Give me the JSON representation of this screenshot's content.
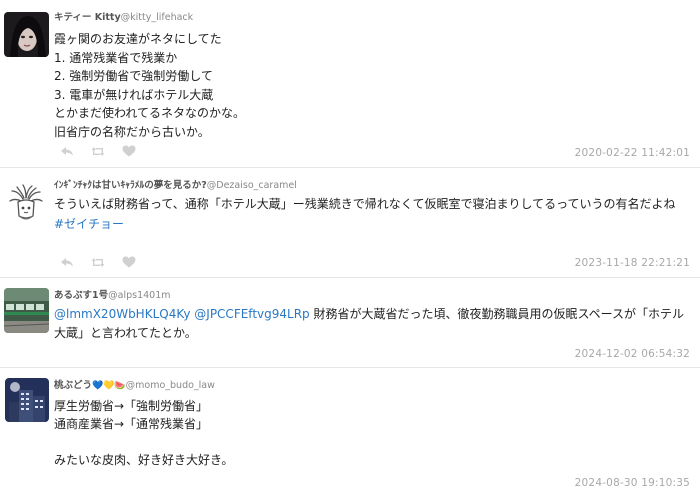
{
  "tweets": [
    {
      "display_name": "キティー Kitty",
      "handle": "@kitty_lifehack",
      "text": "霞ヶ関のお友達がネタにしてた\n1. 通常残業省で残業か\n2. 強制労働省で強制労働して\n3. 電車が無ければホテル大蔵\nとかまだ使われてるネタなのかな。\n旧省庁の名称だから古いか。",
      "timestamp": "2020-02-22 11:42:01"
    },
    {
      "display_name": "ｲﾝｷﾞﾝﾁｬｸは甘いｷｬﾗﾒﾙの夢を見るか?",
      "handle": "@Dezaiso_caramel",
      "text": "そういえば財務省って、通称「ホテル大蔵」ー残業続きで帰れなくて仮眠室で寝泊まりしてるっていうの有名だよね",
      "hashtag": "#ゼイチョー",
      "timestamp": "2023-11-18 22:21:21"
    },
    {
      "display_name": "あるぷす1号",
      "handle": "@alps1401m",
      "mention1": "@lmmX20WbHKLQ4Ky",
      "mention2": "@JPCCFEftvg94LRp",
      "text": "財務省が大蔵省だった頃、徹夜勤務職員用の仮眠スペースが「ホテル大蔵」と言われてたとか。",
      "timestamp": "2024-12-02 06:54:32"
    },
    {
      "display_name": "桃ぶどう",
      "emoji": "💙💛🍉",
      "handle": "@momo_budo_law",
      "text": "厚生労働省→「強制労働省」\n通商産業省→「通常残業省」\n\nみたいな皮肉、好き好き大好き。",
      "timestamp": "2024-08-30 19:10:35"
    }
  ],
  "icons": [
    "reply-icon",
    "retweet-icon",
    "like-icon"
  ],
  "colors": {
    "link": "#2a78c4",
    "timestamp": "#a8a8a8",
    "action_icon": "#d0d0d0",
    "divider": "#e6e6e6"
  }
}
